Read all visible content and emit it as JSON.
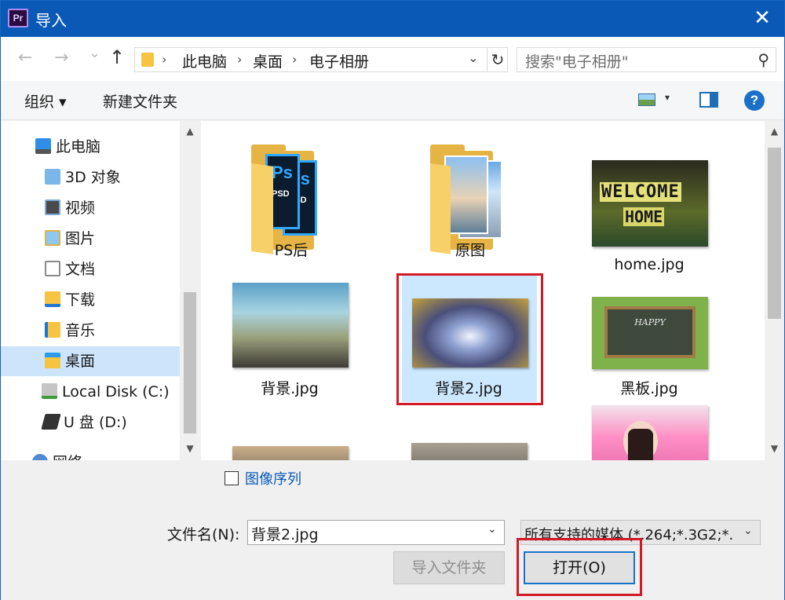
{
  "window": {
    "title": "导入",
    "app_icon": "Pr",
    "close": "✕"
  },
  "address": {
    "back": "←",
    "forward": "→",
    "recent": "⌄",
    "up": "↑",
    "crumbs": [
      "此电脑",
      "桌面",
      "电子相册"
    ],
    "refresh": "↻",
    "search_placeholder": "搜索\"电子相册\""
  },
  "toolbar": {
    "organize": "组织 ▾",
    "new_folder": "新建文件夹",
    "help": "?"
  },
  "nav": {
    "items": [
      {
        "label": "此电脑",
        "icon": "computer-icon"
      },
      {
        "label": "3D 对象",
        "icon": "3d-objects-icon"
      },
      {
        "label": "视频",
        "icon": "video-folder-icon"
      },
      {
        "label": "图片",
        "icon": "pictures-folder-icon"
      },
      {
        "label": "文档",
        "icon": "documents-folder-icon"
      },
      {
        "label": "下载",
        "icon": "downloads-folder-icon"
      },
      {
        "label": "音乐",
        "icon": "music-folder-icon"
      },
      {
        "label": "桌面",
        "icon": "desktop-folder-icon",
        "selected": true
      },
      {
        "label": "Local Disk (C:)",
        "icon": "local-disk-icon"
      },
      {
        "label": "U 盘 (D:)",
        "icon": "usb-drive-icon"
      },
      {
        "label": "网络",
        "icon": "network-icon"
      }
    ]
  },
  "files": [
    {
      "name": "PS后",
      "kind": "folder"
    },
    {
      "name": "原图",
      "kind": "folder"
    },
    {
      "name": "home.jpg",
      "kind": "image",
      "thumb_text_1": "WELCOME",
      "thumb_text_2": "HOME"
    },
    {
      "name": "背景.jpg",
      "kind": "image"
    },
    {
      "name": "背景2.jpg",
      "kind": "image",
      "selected": true
    },
    {
      "name": "黑板.jpg",
      "kind": "image",
      "thumb_text": "HAPPY"
    },
    {
      "name": "",
      "kind": "image"
    },
    {
      "name": "",
      "kind": "image"
    },
    {
      "name": "",
      "kind": "image"
    }
  ],
  "bottom": {
    "image_sequence": "图像序列",
    "filename_label": "文件名(N):",
    "filename_value": "背景2.jpg",
    "filter_value": "所有支持的媒体 (*.264;*.3G2;*.",
    "import_folder": "导入文件夹",
    "open": "打开(O)"
  },
  "colors": {
    "titlebar": "#0a59b7",
    "selection": "#cce8ff",
    "highlight_box": "#d11a26"
  }
}
